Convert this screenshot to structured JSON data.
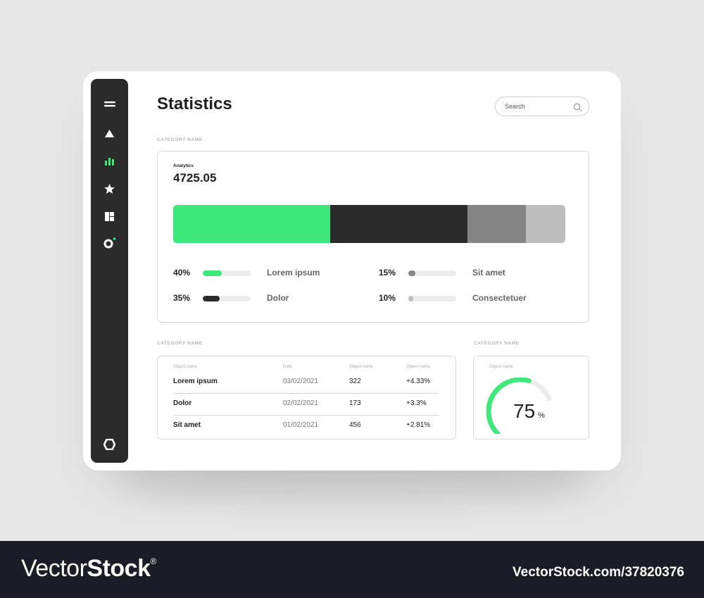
{
  "colors": {
    "accent": "#3ee87b",
    "dark": "#2b2b2b",
    "mid": "#858585",
    "light": "#bdbdbd",
    "track": "#ececec"
  },
  "sidebar": {
    "items": [
      {
        "icon": "menu-icon"
      },
      {
        "icon": "triangle-icon"
      },
      {
        "icon": "bar-chart-icon",
        "active": true
      },
      {
        "icon": "star-icon"
      },
      {
        "icon": "dashboard-icon"
      },
      {
        "icon": "circle-notification-icon"
      }
    ],
    "bottom_icon": "hexagon-settings-icon"
  },
  "header": {
    "title": "Statistics",
    "search_placeholder": "Search"
  },
  "analytics": {
    "category_label": "CATEGORY NAME",
    "label": "Analytics",
    "value": "4725.05",
    "segments": [
      {
        "name": "Lorem ipsum",
        "percent": 40,
        "percent_label": "40%",
        "color": "#3ee87b"
      },
      {
        "name": "Dolor",
        "percent": 35,
        "percent_label": "35%",
        "color": "#2b2b2b"
      },
      {
        "name": "Sit amet",
        "percent": 15,
        "percent_label": "15%",
        "color": "#858585"
      },
      {
        "name": "Consectetuer",
        "percent": 10,
        "percent_label": "10%",
        "color": "#bdbdbd"
      }
    ]
  },
  "table": {
    "category_label": "CATEGORY NAME",
    "headers": [
      "Object name",
      "Date",
      "Object name",
      "Object name"
    ],
    "rows": [
      [
        "Lorem ipsum",
        "03/02/2021",
        "322",
        "+4.33%"
      ],
      [
        "Dolor",
        "02/02/2021",
        "173",
        "+3.3%"
      ],
      [
        "Sit amet",
        "01/02/2021",
        "456",
        "+2.81%"
      ]
    ]
  },
  "gauge": {
    "category_label": "CATEGORY NAME",
    "label": "Object name",
    "value": 75,
    "value_label": "75",
    "unit": "%"
  },
  "watermark": {
    "brand_light": "Vector",
    "brand_bold": "Stock",
    "registered": "®",
    "image_ref": "VectorStock.com/37820376"
  }
}
